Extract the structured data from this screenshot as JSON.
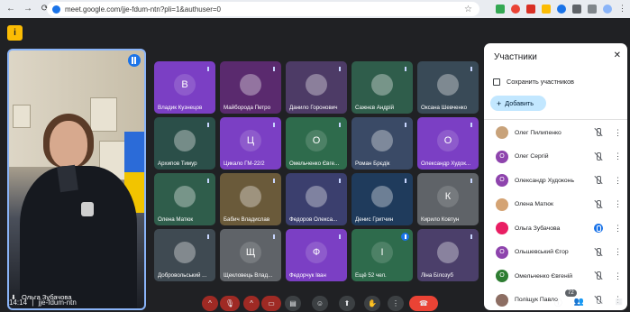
{
  "browser": {
    "url": "meet.google.com/jje-fdum-ntn?pli=1&authuser=0"
  },
  "main_speaker": {
    "name": "Ольга Зубачова"
  },
  "grid": [
    {
      "name": "Владик Кузнецов",
      "avatar_letter": "В",
      "color": "#7b3fc4",
      "muted": true
    },
    {
      "name": "Майборода Петро",
      "avatar_letter": "",
      "color": "#5a2a6e",
      "muted": true
    },
    {
      "name": "Данило Горонович",
      "avatar_letter": "",
      "color": "#4d3b66",
      "muted": true
    },
    {
      "name": "Сажнєв Андрій",
      "avatar_letter": "",
      "color": "#2f5d4b",
      "muted": true
    },
    {
      "name": "Оксана Шевченко",
      "avatar_letter": "",
      "color": "#394a57",
      "muted": true
    },
    {
      "name": "Архипов Тимур",
      "avatar_letter": "",
      "color": "#2b4f49",
      "muted": true
    },
    {
      "name": "Цикало ГМ-22/2",
      "avatar_letter": "Ц",
      "color": "#7b3fc4",
      "muted": true
    },
    {
      "name": "Омельченко Євге...",
      "avatar_letter": "О",
      "color": "#2e6b4c",
      "muted": true
    },
    {
      "name": "Роман Брєдік",
      "avatar_letter": "",
      "color": "#3a4a66",
      "muted": true
    },
    {
      "name": "Олександр Худок...",
      "avatar_letter": "О",
      "color": "#7b3fc4",
      "muted": true
    },
    {
      "name": "Олена Матюк",
      "avatar_letter": "",
      "color": "#2f5d4b",
      "muted": true
    },
    {
      "name": "Бабич Владислав",
      "avatar_letter": "",
      "color": "#6a5a3a",
      "muted": true
    },
    {
      "name": "Федоров Олекса...",
      "avatar_letter": "",
      "color": "#3b3f6e",
      "muted": true
    },
    {
      "name": "Денис Гритчин",
      "avatar_letter": "",
      "color": "#1f3b5c",
      "muted": true
    },
    {
      "name": "Кирило Ковтун",
      "avatar_letter": "К",
      "color": "#5f6368",
      "muted": true
    },
    {
      "name": "Добровольський ...",
      "avatar_letter": "",
      "color": "#3f4a52",
      "muted": true
    },
    {
      "name": "Щекловець Влад...",
      "avatar_letter": "Щ",
      "color": "#5f6368",
      "muted": true
    },
    {
      "name": "Федорчук Іван",
      "avatar_letter": "Ф",
      "color": "#7b3fc4",
      "muted": true
    },
    {
      "name": "Ещё 52 чел.",
      "avatar_letter": "I",
      "color": "#2e6b4c",
      "muted": false
    },
    {
      "name": "Ліна Білозуб",
      "avatar_letter": "",
      "color": "#4b3f6a",
      "muted": true
    }
  ],
  "bottom": {
    "clock": "14:14",
    "meeting_code": "jje-fdum-ntn",
    "participants_count": "72"
  },
  "panel": {
    "title": "Участники",
    "save_label": "Сохранить участников",
    "add_label": "Добавить",
    "participants": [
      {
        "name": "Олег Пилипенко",
        "avatar": "",
        "color": "#c8a27a",
        "speaking": false
      },
      {
        "name": "Олег Сергій",
        "avatar": "О",
        "color": "#8e44ad",
        "speaking": false
      },
      {
        "name": "Олександр Худоконь",
        "avatar": "О",
        "color": "#8e44ad",
        "speaking": false
      },
      {
        "name": "Олена Матюк",
        "avatar": "",
        "color": "#d4a373",
        "speaking": false
      },
      {
        "name": "Ольга Зубачова",
        "avatar": "",
        "color": "#e91e63",
        "speaking": true
      },
      {
        "name": "Ольшевський Єгор",
        "avatar": "О",
        "color": "#8e44ad",
        "speaking": false
      },
      {
        "name": "Омельченко Євгеній",
        "avatar": "О",
        "color": "#2e7d32",
        "speaking": false
      },
      {
        "name": "Поліщук Павло",
        "avatar": "",
        "color": "#8d6e63",
        "speaking": false
      }
    ]
  }
}
